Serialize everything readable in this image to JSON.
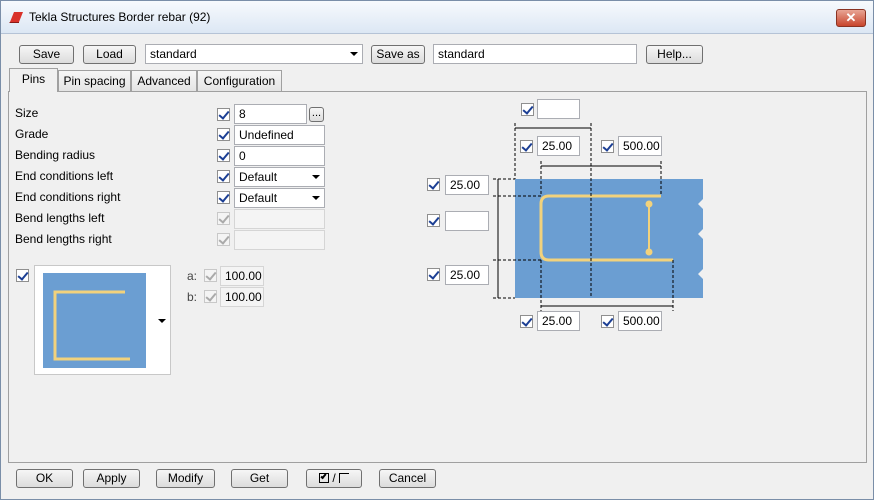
{
  "window": {
    "title": "Tekla Structures  Border rebar (92)"
  },
  "toolbar": {
    "save_label": "Save",
    "load_label": "Load",
    "load_value": "standard",
    "save_as_label": "Save as",
    "save_as_value": "standard",
    "help_label": "Help..."
  },
  "tabs": [
    {
      "label": "Pins",
      "active": true
    },
    {
      "label": "Pin spacing"
    },
    {
      "label": "Advanced"
    },
    {
      "label": "Configuration"
    }
  ],
  "pins": {
    "size": {
      "label": "Size",
      "value": "8",
      "browse": "..."
    },
    "grade": {
      "label": "Grade",
      "value": "Undefined"
    },
    "bending_radius": {
      "label": "Bending radius",
      "value": "0"
    },
    "end_left": {
      "label": "End conditions left",
      "value": "Default"
    },
    "end_right": {
      "label": "End conditions right",
      "value": "Default"
    },
    "bend_left": {
      "label": "Bend lengths left",
      "value": ""
    },
    "bend_right": {
      "label": "Bend lengths right",
      "value": ""
    },
    "a": {
      "label": "a:",
      "value": "100.00"
    },
    "b": {
      "label": "b:",
      "value": "100.00"
    }
  },
  "diagram": {
    "top_empty": "",
    "top_left": "25.00",
    "top_right": "500.00",
    "left_top": "25.00",
    "left_mid": "",
    "left_bottom": "25.00",
    "bottom_left": "25.00",
    "bottom_right": "500.00",
    "fill_color": "#6b9ed2",
    "rebar_color": "#f2d27c"
  },
  "footer": {
    "ok_label": "OK",
    "apply_label": "Apply",
    "modify_label": "Modify",
    "get_label": "Get",
    "toggle_label": "/",
    "cancel_label": "Cancel"
  }
}
